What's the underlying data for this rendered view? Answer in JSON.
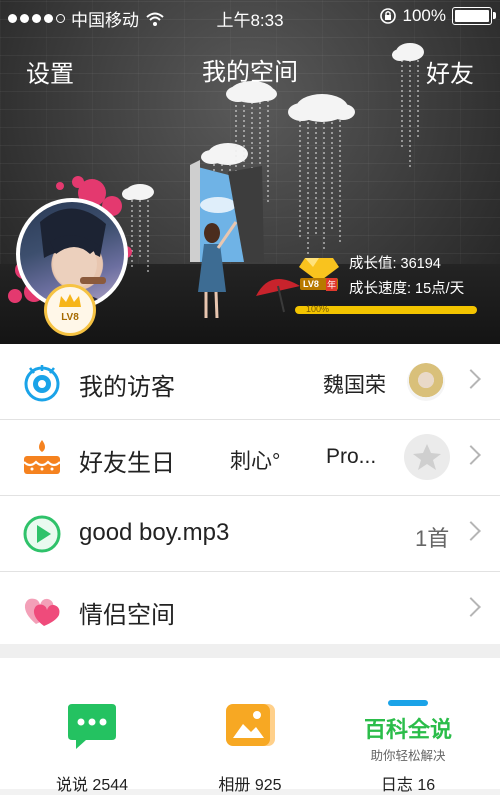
{
  "status_bar": {
    "carrier": "中国移动",
    "time": "上午8:33",
    "battery": "100%"
  },
  "nav": {
    "left": "设置",
    "title": "我的空间",
    "right": "好友"
  },
  "profile": {
    "level_badge": "LV8",
    "level_badge_suffix": "年",
    "avatar_level": "LV8"
  },
  "growth": {
    "value_label": "成长值: 36194",
    "speed_label": "成长速度: 15点/天",
    "progress_text": "100%",
    "progress": 1.0
  },
  "list": {
    "visitors": {
      "label": "我的访客",
      "name": "魏国荣",
      "icon": "eye-icon"
    },
    "birthday": {
      "label": "好友生日",
      "name1": "刺心°",
      "name2": "Pro...",
      "icon": "birthday-cake-icon"
    },
    "music": {
      "label": "good boy.mp3",
      "count": "1首",
      "icon": "play-icon"
    },
    "couple": {
      "label": "情侣空间",
      "icon": "hearts-icon"
    }
  },
  "tiles": {
    "shuoshuo": "说说 2544",
    "album": "相册 925",
    "diary": "日志 16"
  },
  "watermark": {
    "title": "百科全说",
    "subtitle": "助你轻松解决"
  },
  "colors": {
    "accent_blue": "#1aa3e8",
    "orange": "#f5821f",
    "green": "#2fc26a",
    "pink": "#ef4b7b",
    "gold": "#f3c400"
  }
}
